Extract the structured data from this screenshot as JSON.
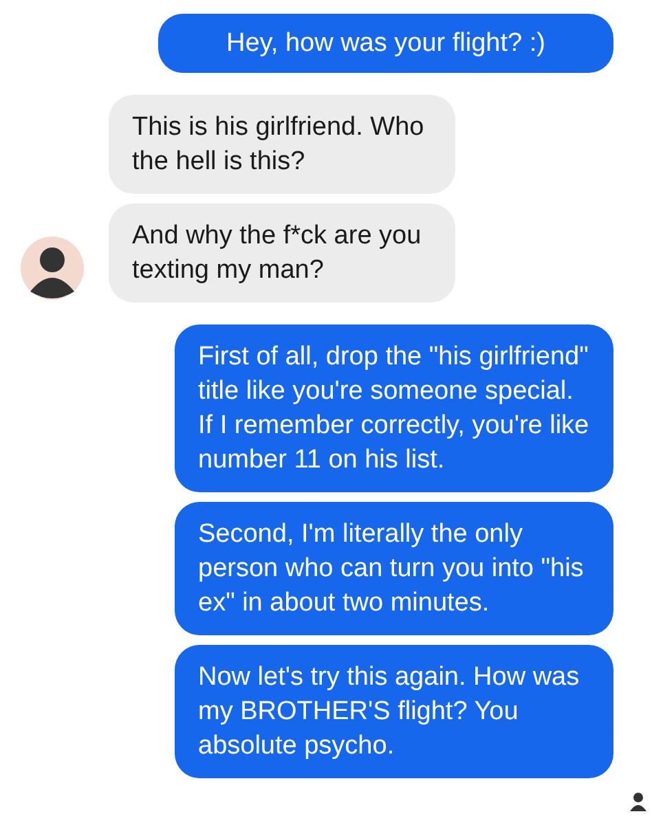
{
  "groups": [
    {
      "kind": "sent",
      "messages": [
        "Hey, how was your flight? :)"
      ]
    },
    {
      "kind": "received",
      "messages": [
        "This is his girlfriend. Who the hell is this?",
        "And why the f*ck are you texting my man?"
      ]
    },
    {
      "kind": "sent",
      "messages": [
        "First of all, drop the \"his girlfriend\" title like you're someone special. If I remember correctly, you're like number 11 on his list.",
        "Second, I'm literally the only person who can turn you into \"his ex\" in about two minutes.",
        "Now let's try this again. How was my BROTHER'S flight? You absolute psycho."
      ]
    }
  ],
  "seen": true
}
